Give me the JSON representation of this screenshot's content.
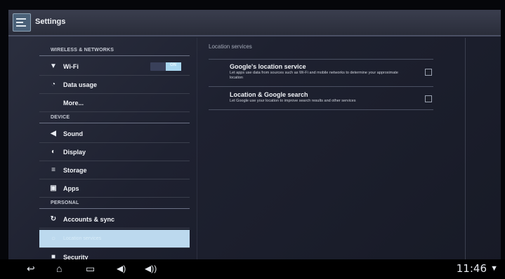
{
  "app": {
    "title": "Settings"
  },
  "sidebar": {
    "sections": [
      {
        "header": "WIRELESS & NETWORKS",
        "items": [
          {
            "label": "Wi-Fi",
            "icon": "wifi-icon",
            "toggle": "ON"
          },
          {
            "label": "Data usage",
            "icon": "data-usage-icon"
          },
          {
            "label": "More...",
            "icon": ""
          }
        ]
      },
      {
        "header": "DEVICE",
        "items": [
          {
            "label": "Sound",
            "icon": "sound-icon"
          },
          {
            "label": "Display",
            "icon": "display-icon"
          },
          {
            "label": "Storage",
            "icon": "storage-icon"
          },
          {
            "label": "Apps",
            "icon": "apps-icon"
          }
        ]
      },
      {
        "header": "PERSONAL",
        "items": [
          {
            "label": "Accounts & sync",
            "icon": "sync-icon"
          },
          {
            "label": "Location services",
            "icon": "location-icon",
            "selected": true
          },
          {
            "label": "Security",
            "icon": "lock-icon"
          }
        ]
      }
    ]
  },
  "main": {
    "title": "Location services",
    "prefs": [
      {
        "title": "Google's location service",
        "summary": "Let apps use data from sources such as Wi-Fi and mobile networks to determine your approximate location",
        "checked": false
      },
      {
        "title": "Location & Google search",
        "summary": "Let Google use your location to improve search results and other services",
        "checked": false
      }
    ]
  },
  "navbar": {
    "time": "11:46"
  }
}
